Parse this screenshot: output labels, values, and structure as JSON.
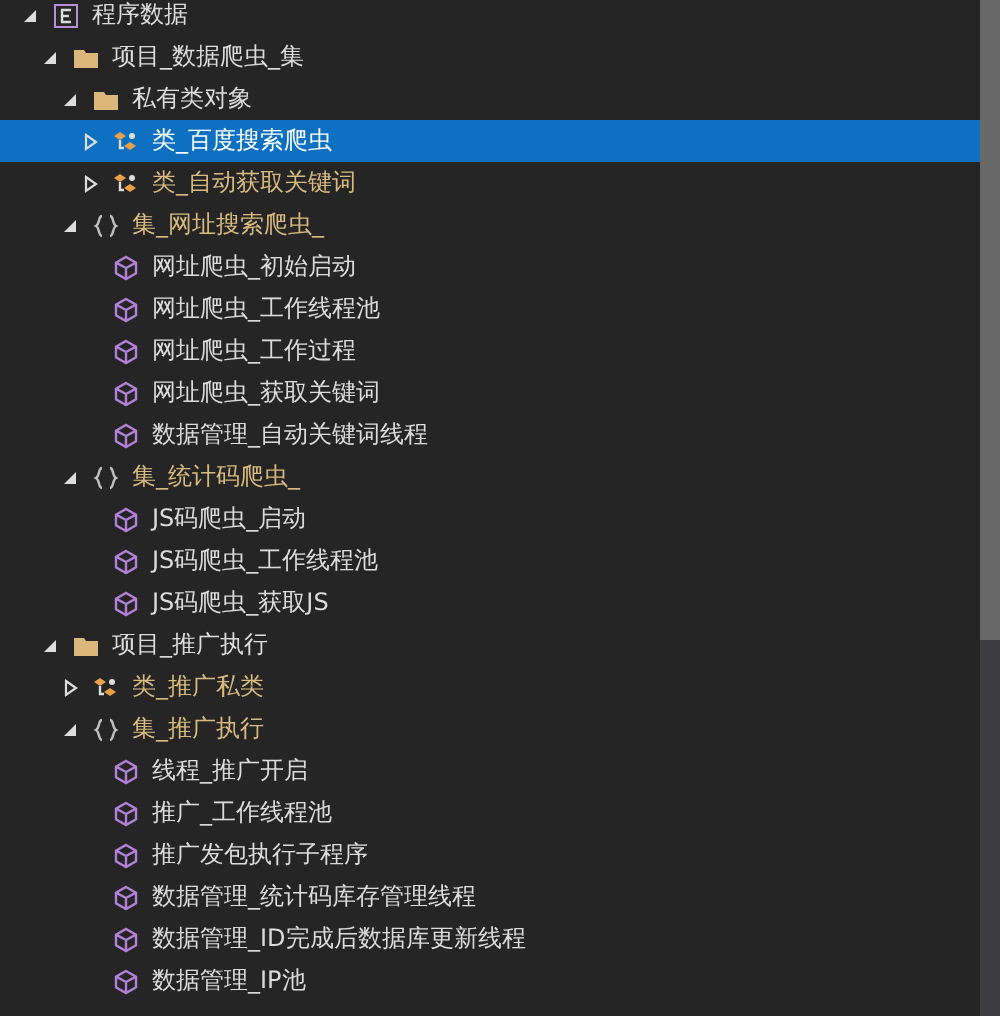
{
  "tree": {
    "items": [
      {
        "kind": "root",
        "label": "程序数据",
        "expanded": true,
        "selected": false,
        "children": [
          {
            "kind": "folder",
            "label": "项目_数据爬虫_集",
            "expanded": true,
            "selected": false,
            "children": [
              {
                "kind": "folder",
                "label": "私有类对象",
                "expanded": true,
                "selected": false,
                "children": [
                  {
                    "kind": "class",
                    "label": "类_百度搜索爬虫",
                    "expanded": false,
                    "selected": true
                  },
                  {
                    "kind": "class",
                    "label": "类_自动获取关键词",
                    "expanded": false,
                    "selected": false
                  }
                ]
              },
              {
                "kind": "namespace",
                "label": "集_网址搜索爬虫_",
                "expanded": true,
                "selected": false,
                "children": [
                  {
                    "kind": "method",
                    "label": "网址爬虫_初始启动",
                    "selected": false
                  },
                  {
                    "kind": "method",
                    "label": "网址爬虫_工作线程池",
                    "selected": false
                  },
                  {
                    "kind": "method",
                    "label": "网址爬虫_工作过程",
                    "selected": false
                  },
                  {
                    "kind": "method",
                    "label": "网址爬虫_获取关键词",
                    "selected": false
                  },
                  {
                    "kind": "method",
                    "label": "数据管理_自动关键词线程",
                    "selected": false
                  }
                ]
              },
              {
                "kind": "namespace",
                "label": "集_统计码爬虫_",
                "expanded": true,
                "selected": false,
                "children": [
                  {
                    "kind": "method",
                    "label": "JS码爬虫_启动",
                    "selected": false
                  },
                  {
                    "kind": "method",
                    "label": "JS码爬虫_工作线程池",
                    "selected": false
                  },
                  {
                    "kind": "method",
                    "label": "JS码爬虫_获取JS",
                    "selected": false
                  }
                ]
              }
            ]
          },
          {
            "kind": "folder",
            "label": "项目_推广执行",
            "expanded": true,
            "selected": false,
            "children": [
              {
                "kind": "class",
                "label": "类_推广私类",
                "expanded": false,
                "selected": false
              },
              {
                "kind": "namespace",
                "label": "集_推广执行",
                "expanded": true,
                "selected": false,
                "children": [
                  {
                    "kind": "method",
                    "label": "线程_推广开启",
                    "selected": false
                  },
                  {
                    "kind": "method",
                    "label": "推广_工作线程池",
                    "selected": false
                  },
                  {
                    "kind": "method",
                    "label": "推广发包执行子程序",
                    "selected": false
                  },
                  {
                    "kind": "method",
                    "label": "数据管理_统计码库存管理线程",
                    "selected": false
                  },
                  {
                    "kind": "method",
                    "label": "数据管理_ID完成后数据库更新线程",
                    "selected": false
                  },
                  {
                    "kind": "method",
                    "label": "数据管理_IP池",
                    "selected": false
                  }
                ]
              }
            ]
          }
        ]
      }
    ]
  }
}
